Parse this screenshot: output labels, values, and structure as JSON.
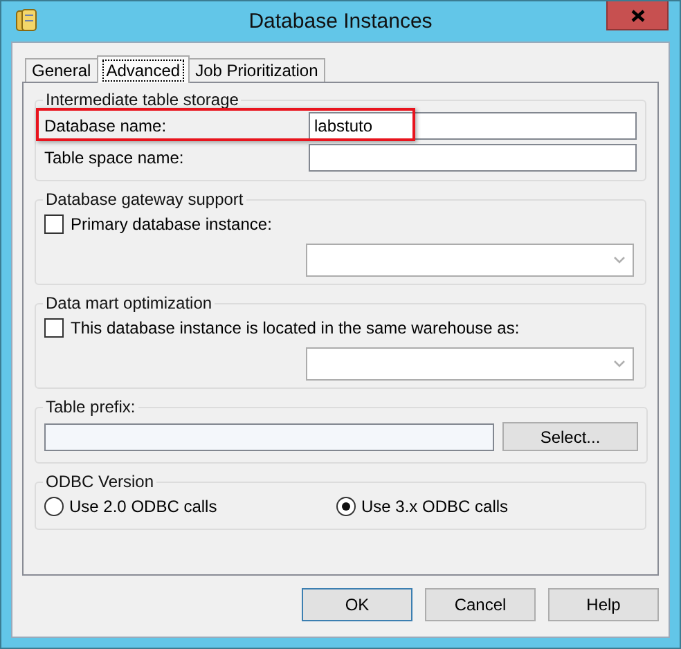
{
  "window": {
    "title": "Database Instances"
  },
  "tabs": [
    {
      "label": "General",
      "selected": false
    },
    {
      "label": "Advanced",
      "selected": true
    },
    {
      "label": "Job Prioritization",
      "selected": false
    }
  ],
  "groups": [
    {
      "kind": "fields",
      "title": "Intermediate table storage",
      "fields": [
        {
          "label": "Database name:",
          "value": "labstuto",
          "highlighted": true
        },
        {
          "label": "Table space name:",
          "highlighted": false
        }
      ]
    },
    {
      "kind": "check_dropdown",
      "title": "Database gateway support",
      "checkbox": {
        "label": "Primary database instance:",
        "checked": false
      }
    },
    {
      "kind": "check_dropdown",
      "title": "Data mart optimization",
      "checkbox": {
        "label": "This database instance is located in the same warehouse as:",
        "checked": false
      }
    },
    {
      "kind": "prefix",
      "title": "Table prefix:",
      "button": "Select..."
    },
    {
      "kind": "radios",
      "title": "ODBC Version",
      "options": [
        {
          "label": "Use 2.0 ODBC calls",
          "selected": false
        },
        {
          "label": "Use 3.x ODBC calls",
          "selected": true
        }
      ]
    }
  ],
  "buttons": [
    {
      "label": "OK",
      "default": true
    },
    {
      "label": "Cancel",
      "default": false
    },
    {
      "label": "Help",
      "default": false
    }
  ]
}
